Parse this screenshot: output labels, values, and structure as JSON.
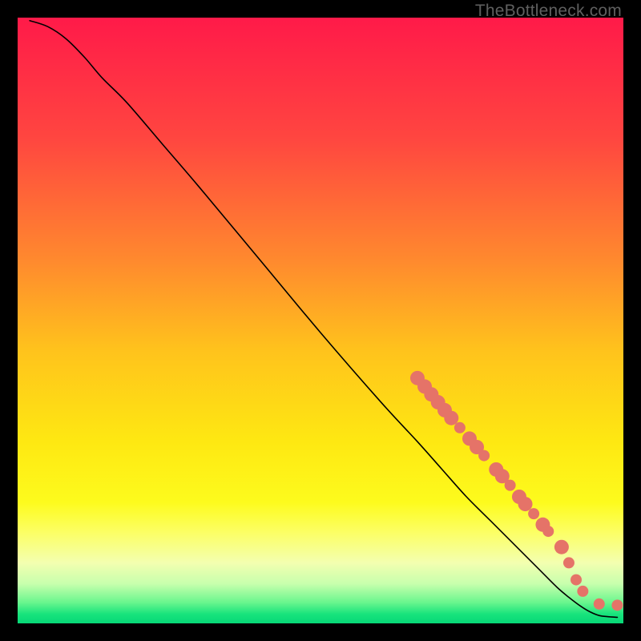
{
  "watermark": "TheBottleneck.com",
  "chart_data": {
    "type": "line",
    "title": "",
    "xlabel": "",
    "ylabel": "",
    "xlim": [
      0,
      100
    ],
    "ylim": [
      0,
      100
    ],
    "grid": false,
    "background_gradient": {
      "stops": [
        {
          "pos": 0.0,
          "color": "#ff1a49"
        },
        {
          "pos": 0.2,
          "color": "#ff4640"
        },
        {
          "pos": 0.4,
          "color": "#ff892e"
        },
        {
          "pos": 0.55,
          "color": "#ffc31c"
        },
        {
          "pos": 0.7,
          "color": "#fee812"
        },
        {
          "pos": 0.8,
          "color": "#fdfb1d"
        },
        {
          "pos": 0.85,
          "color": "#fcff65"
        },
        {
          "pos": 0.9,
          "color": "#f3ffb0"
        },
        {
          "pos": 0.935,
          "color": "#c7ffad"
        },
        {
          "pos": 0.965,
          "color": "#6bf68e"
        },
        {
          "pos": 0.985,
          "color": "#17e37c"
        },
        {
          "pos": 1.0,
          "color": "#07d877"
        }
      ]
    },
    "series": [
      {
        "name": "bottleneck-curve",
        "stroke": "#000000",
        "stroke_width": 1.6,
        "x": [
          2,
          5,
          8,
          11,
          14,
          18,
          24,
          30,
          40,
          50,
          60,
          66,
          70,
          74,
          78,
          82,
          86,
          89,
          91,
          93,
          94.5,
          96,
          97.5,
          99
        ],
        "y": [
          99.5,
          98.5,
          96.5,
          93.5,
          90,
          86,
          79,
          72,
          60,
          48,
          36.5,
          30,
          25.5,
          21,
          17,
          13,
          9,
          6,
          4.3,
          2.8,
          1.9,
          1.3,
          1.1,
          1.0
        ]
      }
    ],
    "markers": {
      "name": "highlight-points",
      "color": "#e57368",
      "radius_small": 7,
      "radius_large": 9,
      "points": [
        {
          "x": 66.0,
          "y": 40.5,
          "r": "l"
        },
        {
          "x": 67.2,
          "y": 39.1,
          "r": "l"
        },
        {
          "x": 68.3,
          "y": 37.8,
          "r": "l"
        },
        {
          "x": 69.4,
          "y": 36.5,
          "r": "l"
        },
        {
          "x": 70.5,
          "y": 35.2,
          "r": "l"
        },
        {
          "x": 71.6,
          "y": 33.9,
          "r": "l"
        },
        {
          "x": 73.0,
          "y": 32.3,
          "r": "s"
        },
        {
          "x": 74.6,
          "y": 30.5,
          "r": "l"
        },
        {
          "x": 75.8,
          "y": 29.1,
          "r": "l"
        },
        {
          "x": 77.0,
          "y": 27.7,
          "r": "s"
        },
        {
          "x": 79.0,
          "y": 25.4,
          "r": "l"
        },
        {
          "x": 80.0,
          "y": 24.3,
          "r": "l"
        },
        {
          "x": 81.3,
          "y": 22.8,
          "r": "s"
        },
        {
          "x": 82.8,
          "y": 20.9,
          "r": "l"
        },
        {
          "x": 83.8,
          "y": 19.7,
          "r": "l"
        },
        {
          "x": 85.2,
          "y": 18.1,
          "r": "s"
        },
        {
          "x": 86.7,
          "y": 16.3,
          "r": "l"
        },
        {
          "x": 87.6,
          "y": 15.2,
          "r": "s"
        },
        {
          "x": 89.8,
          "y": 12.6,
          "r": "l"
        },
        {
          "x": 91.0,
          "y": 10.0,
          "r": "s"
        },
        {
          "x": 92.2,
          "y": 7.2,
          "r": "s"
        },
        {
          "x": 93.3,
          "y": 5.3,
          "r": "s"
        },
        {
          "x": 96.0,
          "y": 3.2,
          "r": "s"
        },
        {
          "x": 99.0,
          "y": 3.0,
          "r": "s"
        }
      ]
    }
  }
}
